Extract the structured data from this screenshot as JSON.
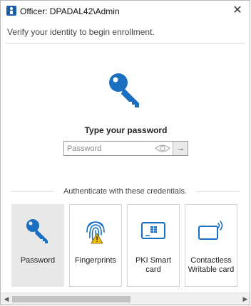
{
  "window": {
    "title": "Officer: DPADAL42\\Admin",
    "close_glyph": "✕"
  },
  "subtitle": "Verify your identity to begin enrollment.",
  "prompt": "Type your password",
  "password": {
    "value": "",
    "placeholder": "Password",
    "submit_glyph": "→"
  },
  "credentials": {
    "heading": "Authenticate with these credentials.",
    "cards": [
      {
        "label": "Password",
        "icon": "key-icon",
        "selected": true
      },
      {
        "label": "Fingerprints",
        "icon": "fingerprint-icon",
        "warning": true
      },
      {
        "label": "PKI  Smart card",
        "icon": "smart-card-icon"
      },
      {
        "label": "Contactless Writable card",
        "icon": "contactless-card-icon"
      }
    ]
  },
  "scrollbar": {
    "left_glyph": "◀",
    "right_glyph": "▶"
  },
  "colors": {
    "accent": "#1a73c8",
    "key_blue": "#1a6fc0",
    "warning": "#f2c200"
  }
}
